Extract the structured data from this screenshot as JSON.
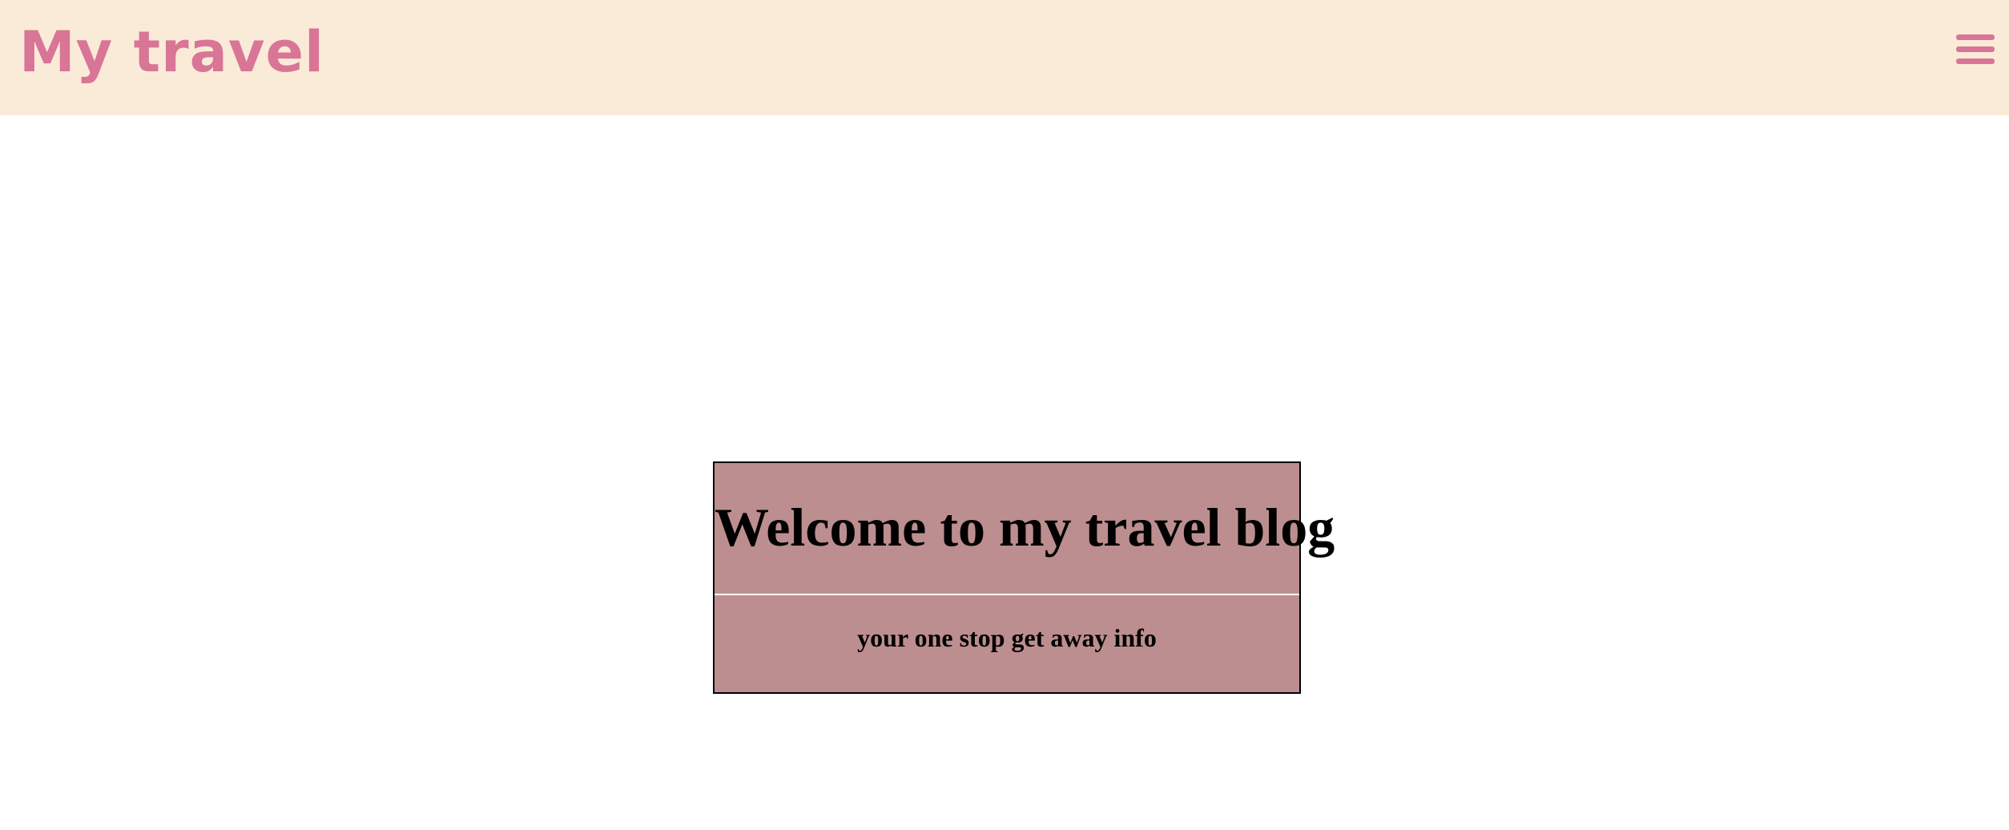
{
  "header": {
    "brand": "My travel",
    "menu_icon": "hamburger-menu-icon"
  },
  "hero": {
    "title": "Welcome to my travel blog",
    "subtitle": "your one stop get away info"
  },
  "colors": {
    "header_background": "#faebd8",
    "brand": "#d97596",
    "hero_background": "#bd8e8f",
    "hero_border": "#000000",
    "page_background": "#ffffff"
  }
}
